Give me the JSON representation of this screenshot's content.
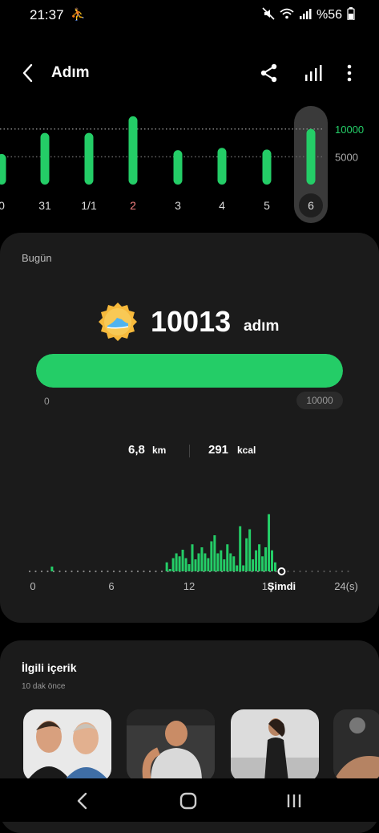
{
  "status_bar": {
    "time": "21:37",
    "notification_icon": "walking-person-icon",
    "icons": [
      "mute-icon",
      "wifi-icon",
      "signal-icon"
    ],
    "battery": "%56",
    "battery_icon": "battery-icon"
  },
  "app_bar": {
    "title": "Adım",
    "icons": [
      "back-arrow-icon",
      "share-icon",
      "bar-chart-icon",
      "more-vertical-icon"
    ]
  },
  "week_chart": {
    "days": [
      "0",
      "31",
      "1/1",
      "2",
      "3",
      "4",
      "5",
      "6"
    ],
    "values": [
      5500,
      9300,
      9300,
      12300,
      6200,
      6600,
      6300,
      10013
    ],
    "highlight_day_index": 3,
    "highlight_color": "#f27f7f",
    "selected_index": 7,
    "goal_line_label": "10000",
    "half_line_label": "5000",
    "bar_color": "#24cd67",
    "ymax": 13000
  },
  "today": {
    "label": "Bugün",
    "steps": "10013",
    "steps_unit": "adım",
    "badge_icon": "running-shoe-badge-icon",
    "progress_fraction": 1.0,
    "progress_min": "0",
    "progress_goal": "10000",
    "distance": "6,8",
    "distance_unit": "km",
    "calories": "291",
    "calories_unit": "kcal"
  },
  "hourly_chart": {
    "x_labels": [
      "0",
      "6",
      "12",
      "18",
      "Şimdi",
      "24(s)"
    ],
    "values": [
      0,
      0,
      0,
      0,
      0,
      0,
      0,
      0,
      0,
      0,
      0,
      0,
      0,
      0,
      0,
      0,
      0,
      0,
      0,
      0,
      0,
      0,
      0,
      0,
      0,
      0,
      0,
      0,
      0,
      0,
      0,
      0,
      0,
      0,
      0,
      0,
      0,
      0,
      0,
      0,
      0,
      0,
      1.5,
      0.4,
      2.2,
      3,
      2.5,
      3.6,
      2.2,
      1.2,
      4.5,
      2,
      3,
      4,
      3,
      2.2,
      5,
      6,
      3,
      3.5,
      2,
      4.5,
      3,
      2.5,
      1,
      7.5,
      1,
      5.5,
      7,
      2,
      3.5,
      4.5,
      2.5,
      4,
      9.5,
      3.5,
      1.5,
      0,
      0,
      0,
      0,
      0,
      0,
      0,
      0,
      0,
      0,
      0,
      0,
      0,
      0,
      0,
      0,
      0,
      0,
      0,
      0,
      0
    ],
    "bump_index": 6,
    "bump_value": 1,
    "now_index": 78,
    "bar_color": "#24cd67",
    "ymax": 10
  },
  "related": {
    "title": "İlgili içerik",
    "time": "10 dak önce",
    "thumbnails": [
      "two-men-photo",
      "gym-man-photo",
      "running-woman-photo",
      "workout-photo"
    ]
  },
  "nav_bar": {
    "icons": [
      "nav-back-icon",
      "nav-home-icon",
      "nav-recents-icon"
    ]
  }
}
